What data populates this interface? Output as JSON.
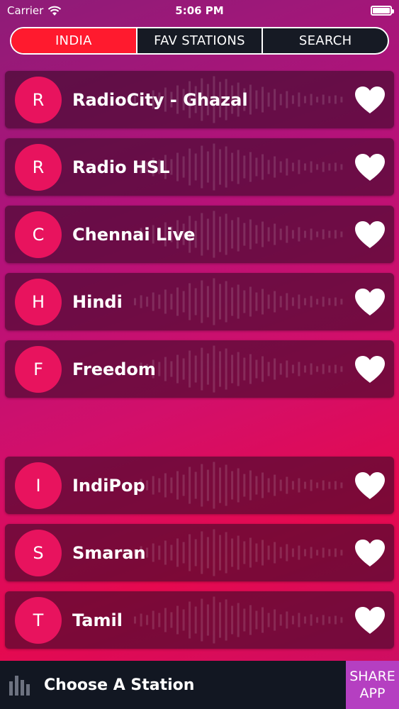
{
  "status_bar": {
    "carrier": "Carrier",
    "time": "5:06 PM"
  },
  "tabs": [
    {
      "label": "INDIA",
      "active": true
    },
    {
      "label": "FAV STATIONS",
      "active": false
    },
    {
      "label": "SEARCH",
      "active": false
    }
  ],
  "stations": [
    {
      "initial": "R",
      "name": "RadioCity - Ghazal"
    },
    {
      "initial": "R",
      "name": "Radio HSL"
    },
    {
      "initial": "C",
      "name": "Chennai Live"
    },
    {
      "initial": "H",
      "name": "Hindi"
    },
    {
      "initial": "F",
      "name": "Freedom"
    },
    {
      "initial": "I",
      "name": "IndiPop"
    },
    {
      "initial": "S",
      "name": "Smaran"
    },
    {
      "initial": "T",
      "name": "Tamil"
    }
  ],
  "player": {
    "now_playing": "Choose A Station",
    "share_line1": "SHARE",
    "share_line2": "APP"
  },
  "colors": {
    "accent_red": "#ff1a2e",
    "avatar_pink": "#e8135e",
    "share_purple": "#b53fc1",
    "bar_dark": "#121722"
  },
  "icons": {
    "wifi": "wifi-icon",
    "battery": "battery-icon",
    "favorite": "heart-icon",
    "player": "equalizer-bars-icon"
  }
}
